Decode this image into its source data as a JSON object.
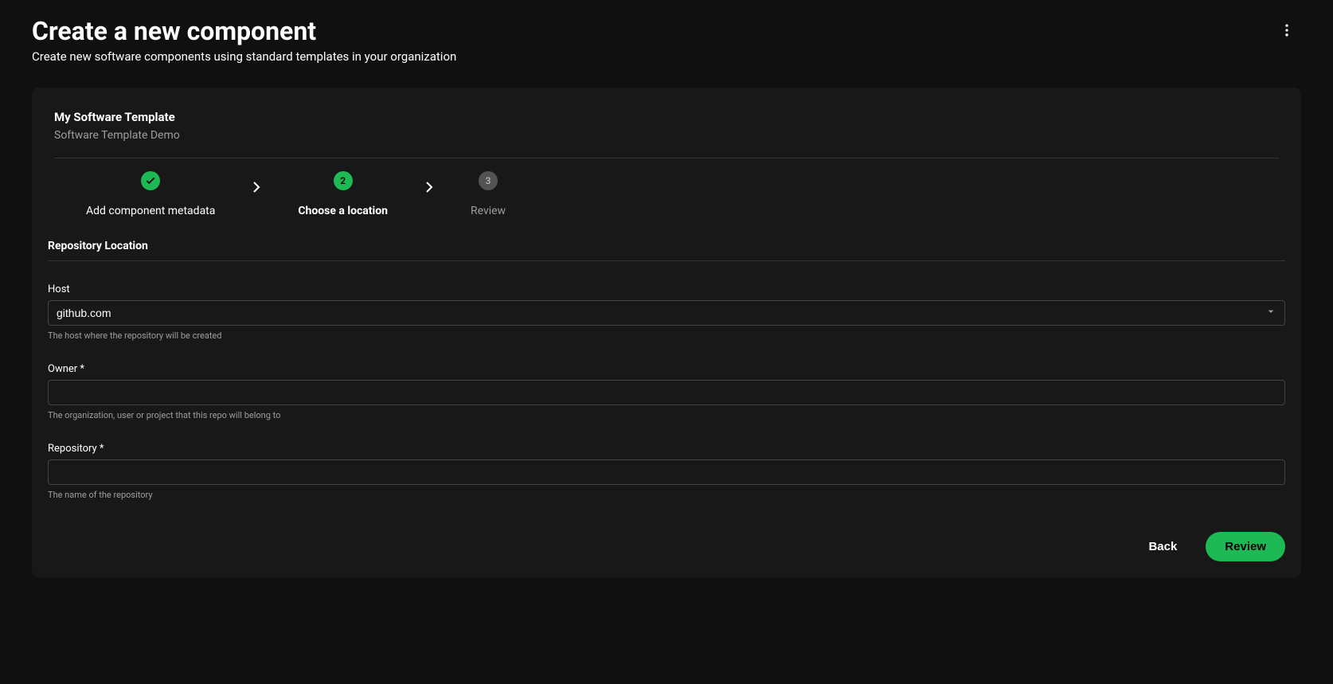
{
  "header": {
    "title": "Create a new component",
    "subtitle": "Create new software components using standard templates in your organization"
  },
  "template": {
    "name": "My Software Template",
    "description": "Software Template Demo"
  },
  "stepper": {
    "steps": [
      {
        "label": "Add component metadata",
        "status": "completed"
      },
      {
        "label": "Choose a location",
        "number": "2",
        "status": "active"
      },
      {
        "label": "Review",
        "number": "3",
        "status": "inactive"
      }
    ]
  },
  "form": {
    "section_title": "Repository Location",
    "host": {
      "label": "Host",
      "value": "github.com",
      "helper": "The host where the repository will be created"
    },
    "owner": {
      "label": "Owner *",
      "value": "",
      "helper": "The organization, user or project that this repo will belong to"
    },
    "repository": {
      "label": "Repository *",
      "value": "",
      "helper": "The name of the repository"
    }
  },
  "buttons": {
    "back": "Back",
    "review": "Review"
  },
  "colors": {
    "accent": "#1db954",
    "background": "#101010",
    "card": "#181818"
  }
}
